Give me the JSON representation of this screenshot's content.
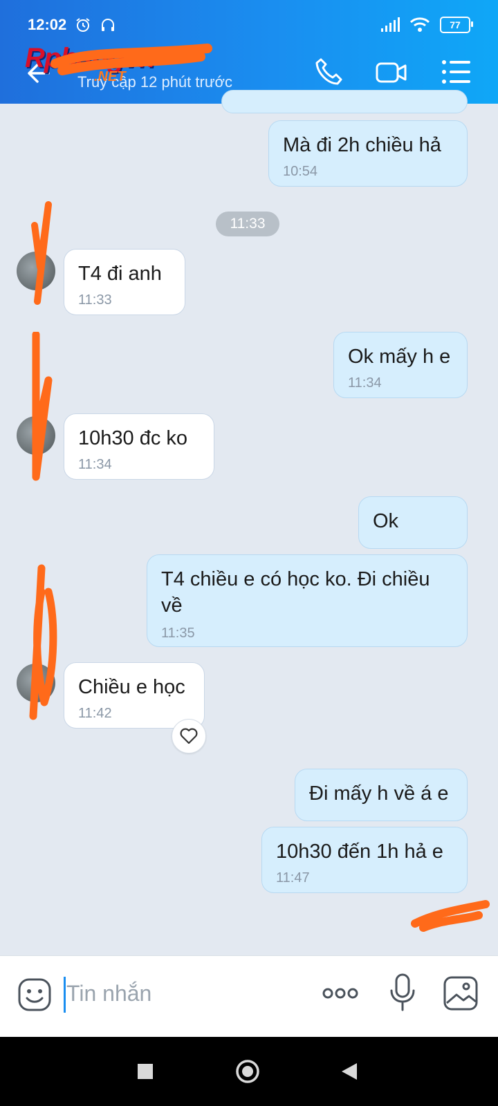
{
  "status_bar": {
    "time": "12:02",
    "battery": "77"
  },
  "header": {
    "subtitle": "Truy cập 12 phút trước",
    "logo_text": "Rphangvn",
    "logo_sub": ".NET"
  },
  "messages": [
    {
      "dir": "out",
      "text": "Mà đi 2h chiều hả",
      "time": "10:54"
    },
    {
      "dir": "in",
      "text": "T4 đi anh",
      "time": "11:33"
    },
    {
      "dir": "out",
      "text": "Ok mấy h e",
      "time": "11:34"
    },
    {
      "dir": "in",
      "text": "10h30 đc ko",
      "time": "11:34"
    },
    {
      "dir": "out",
      "text": "Ok",
      "time": ""
    },
    {
      "dir": "out",
      "text": "T4 chiều e có học ko. Đi chiều về",
      "line1": "T4 chiều e có học ko. Đi chiều",
      "line2": "về",
      "time": "11:35"
    },
    {
      "dir": "in",
      "text": "Chiều e học",
      "time": "11:42"
    },
    {
      "dir": "out",
      "text": "Đi mấy h về á e",
      "time": ""
    },
    {
      "dir": "out",
      "text": "10h30 đến 1h hả e",
      "time": "11:47"
    }
  ],
  "time_separator": "11:33",
  "input": {
    "placeholder": "Tin nhắn"
  },
  "colors": {
    "header_start": "#1f6fdc",
    "header_end": "#0fa7f7",
    "out_bubble": "#d6eefd",
    "in_bubble": "#ffffff",
    "chat_bg": "#e3e9f1",
    "scribble": "#ff6a1a"
  },
  "icons": [
    "back-arrow-icon",
    "phone-icon",
    "video-call-icon",
    "menu-icon",
    "emoji-icon",
    "more-icon",
    "microphone-icon",
    "image-icon",
    "heart-icon",
    "home-square-icon",
    "circle-home-icon",
    "back-triangle-icon",
    "alarm-icon",
    "headphones-icon",
    "signal-icon",
    "wifi-icon",
    "battery-icon"
  ]
}
